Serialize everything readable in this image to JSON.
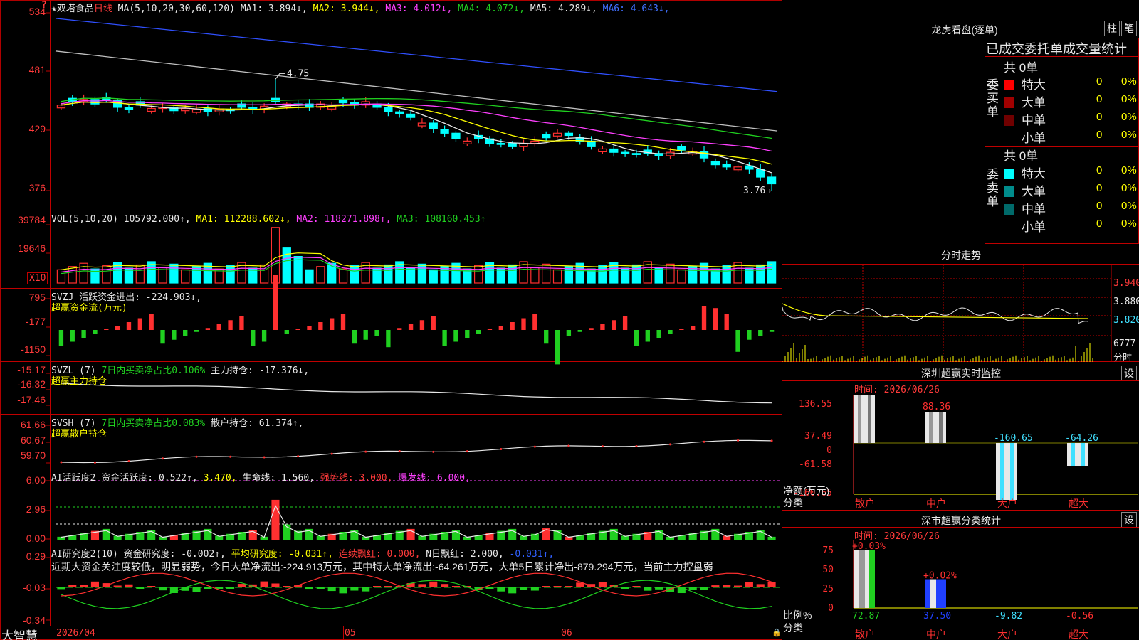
{
  "colors": {
    "up": "#ff3030",
    "down": "#00ffff",
    "ma1": "#e8e8e8",
    "ma2": "#ffff00",
    "ma3": "#ff40ff",
    "ma4": "#20d020",
    "ma5": "#c0c0c0",
    "ma6": "#3050ff"
  },
  "kline": {
    "title": "★双塔食品",
    "period": "日线",
    "ma_params": "MA(5,10,20,30,60,120)",
    "ma": [
      {
        "label": "MA1: 3.894↓",
        "cls": "w"
      },
      {
        "label": "MA2: 3.944↓",
        "cls": "y"
      },
      {
        "label": "MA3: 4.012↓",
        "cls": "m"
      },
      {
        "label": "MA4: 4.072↓",
        "cls": "g"
      },
      {
        "label": "MA5: 4.289↓",
        "cls": "w"
      },
      {
        "label": "MA6: 4.643↓",
        "cls": "bl"
      }
    ],
    "y_ticks": [
      "534",
      "481",
      "429",
      "376"
    ],
    "high_mark": "4.75",
    "low_mark": "3.76",
    "corner_mark": "?"
  },
  "volume": {
    "header": [
      {
        "t": "VOL(5,10,20) ",
        "cls": "w"
      },
      {
        "t": "105792.000↑, ",
        "cls": "w"
      },
      {
        "t": "MA1: 112288.602↓, ",
        "cls": "y"
      },
      {
        "t": "MA2: 118271.898↑, ",
        "cls": "m"
      },
      {
        "t": "MA3: 108160.453↑",
        "cls": "g"
      }
    ],
    "y_ticks": [
      "39784",
      "19646"
    ],
    "unit": "X10"
  },
  "svzj": {
    "header": [
      {
        "t": "SVZJ  活跃资金进出: -224.903↓,",
        "cls": "w"
      }
    ],
    "sub": "超赢资金流(万元)",
    "y_ticks": [
      "795",
      "-177",
      "-1150"
    ]
  },
  "svzl": {
    "header": [
      {
        "t": "SVZL (7) ",
        "cls": "w"
      },
      {
        "t": "7日内买卖净占比0.106% ",
        "cls": "g"
      },
      {
        "t": "主力持仓: -17.376↓,",
        "cls": "w"
      }
    ],
    "sub": "超赢主力持仓",
    "y_ticks": [
      "-15.17",
      "-16.32",
      "-17.46"
    ]
  },
  "svsh": {
    "header": [
      {
        "t": "SVSH (7) ",
        "cls": "w"
      },
      {
        "t": "7日内买卖净占比0.083% ",
        "cls": "g"
      },
      {
        "t": "散户持仓: 61.374↑,",
        "cls": "w"
      }
    ],
    "sub": "超赢散户持仓",
    "y_ticks": [
      "61.66",
      "60.67",
      "59.70"
    ]
  },
  "ai_active": {
    "header": [
      {
        "t": "AI活跃度2 资金活跃度: 0.522↑, ",
        "cls": "w"
      },
      {
        "t": "3.470, ",
        "cls": "y"
      },
      {
        "t": "生命线: 1.560, ",
        "cls": "w"
      },
      {
        "t": "强势线: 3.000, ",
        "cls": "r"
      },
      {
        "t": "爆发线: 6.000,",
        "cls": "m"
      }
    ],
    "y_ticks": [
      "6.00",
      "2.96",
      "0.00"
    ]
  },
  "ai_research": {
    "header": [
      {
        "t": "AI研究度2(10) 资金研究度: -0.002↑, ",
        "cls": "w"
      },
      {
        "t": "平均研究度: -0.031↑, ",
        "cls": "y"
      },
      {
        "t": "连续飘红: 0.000, ",
        "cls": "r"
      },
      {
        "t": "N日飘红: 2.000, ",
        "cls": "w"
      },
      {
        "t": "-0.031↑,",
        "cls": "b"
      }
    ],
    "comment": "近期大资金关注度较低，明显弱势，今日大单净流出:-224.913万元，其中特大单净流出:-64.261万元，大单5日累计净出-879.294万元，当前主力控盘弱",
    "y_ticks": [
      "0.29",
      "-0.03",
      "-0.34"
    ]
  },
  "date_axis": {
    "start": "2026/04",
    "m1": "05",
    "m2": "06"
  },
  "brand": "大智慧",
  "lhb": {
    "title": "龙虎看盘(逐单)",
    "btn1": "柱",
    "btn2": "笔",
    "col_header": "已成交委托单成交量统计",
    "buy": {
      "label": "委买单",
      "total": "共 0单",
      "rows": [
        {
          "name": "特大",
          "val": "0",
          "pct": "0%",
          "color": "#ff0000"
        },
        {
          "name": "大单",
          "val": "0",
          "pct": "0%",
          "color": "#a00000"
        },
        {
          "name": "中单",
          "val": "0",
          "pct": "0%",
          "color": "#700000"
        },
        {
          "name": "小单",
          "val": "0",
          "pct": "0%",
          "color": "#000000"
        }
      ]
    },
    "sell": {
      "label": "委卖单",
      "total": "共 0单",
      "rows": [
        {
          "name": "特大",
          "val": "0",
          "pct": "0%",
          "color": "#00ffff"
        },
        {
          "name": "大单",
          "val": "0",
          "pct": "0%",
          "color": "#008c8c"
        },
        {
          "name": "中单",
          "val": "0",
          "pct": "0%",
          "color": "#006a6a"
        },
        {
          "name": "小单",
          "val": "0",
          "pct": "0%",
          "color": "#000000"
        }
      ]
    }
  },
  "intraday": {
    "title": "分时走势",
    "y_ticks": [
      "3.940",
      "3.880",
      "3.820"
    ],
    "vol_tick": "6777",
    "vol_label": "分时"
  },
  "sz_monitor": {
    "title": "深圳超赢实时监控",
    "set": "设",
    "time": "时间: 2026/06/26",
    "y_ticks": [
      "136.55",
      "37.49",
      "0",
      "-61.58",
      "-160.65"
    ],
    "axis_title": "净额(万元)",
    "axis_sub": "分类",
    "bars": [
      {
        "name": "散户",
        "value": 136.55,
        "label": "136.55"
      },
      {
        "name": "中户",
        "value": 88.36,
        "label": "88.36"
      },
      {
        "name": "大户",
        "value": -160.65,
        "label": "-160.65"
      },
      {
        "name": "超大",
        "value": -64.26,
        "label": "-64.26"
      }
    ]
  },
  "sz_classify": {
    "title": "深市超赢分类统计",
    "set": "设",
    "time": "时间: 2026/06/26",
    "y_ticks": [
      "75",
      "50",
      "25",
      "0"
    ],
    "axis_title": "比例%",
    "axis_sub": "分类",
    "bars": [
      {
        "name": "散户",
        "value": 75,
        "top": "+0.03%",
        "bottom": "72.87"
      },
      {
        "name": "中户",
        "value": 37,
        "top": "+0.02%",
        "bottom": "37.50"
      },
      {
        "name": "大户",
        "value": 0,
        "top": "",
        "bottom": "-9.82"
      },
      {
        "name": "超大",
        "value": 0,
        "top": "",
        "bottom": "-0.56"
      }
    ]
  }
}
